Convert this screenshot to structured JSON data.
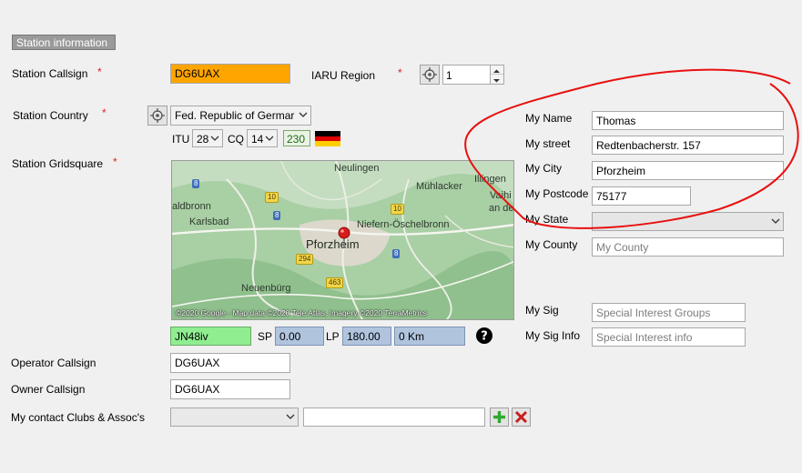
{
  "header": {
    "title": "Station information"
  },
  "callsign": {
    "label": "Station Callsign",
    "value": "DG6UAX"
  },
  "iaru": {
    "label": "IARU Region",
    "value": "1"
  },
  "country": {
    "label": "Station Country",
    "value": "Fed. Republic of Germar",
    "flag_icon": "germany-flag-icon"
  },
  "zones": {
    "itu_label": "ITU",
    "itu_value": "28",
    "cq_label": "CQ",
    "cq_value": "14",
    "dxcc": "230"
  },
  "gridsquare": {
    "label": "Station Gridsquare",
    "value": "JN48iv"
  },
  "map": {
    "places": [
      "Neulingen",
      "Mühlacker",
      "Illingen",
      "aldbronn",
      "Vaihi",
      "an de",
      "Karlsbad",
      "Niefern-Öschelbronn",
      "Pforzheim",
      "Neuenbürg"
    ],
    "roads": [
      "8",
      "10",
      "8",
      "10",
      "294",
      "8",
      "463"
    ],
    "credit": "©2020 Google - Map data ©2020 Tele Atlas, Imagery ©2020 TerraMetrics"
  },
  "bearing": {
    "sp_label": "SP",
    "sp_value": "0.00",
    "lp_label": "LP",
    "lp_value": "180.00",
    "distance": "0 Km",
    "help_icon": "help-icon"
  },
  "operator": {
    "label": "Operator Callsign",
    "value": "DG6UAX"
  },
  "owner": {
    "label": "Owner Callsign",
    "value": "DG6UAX"
  },
  "clubs": {
    "label": "My contact Clubs & Assoc's",
    "select_value": "",
    "text_value": "",
    "add_icon": "plus-icon",
    "remove_icon": "close-icon"
  },
  "personal": {
    "name_label": "My Name",
    "name_value": "Thomas",
    "street_label": "My street",
    "street_value": "Redtenbacherstr. 157",
    "city_label": "My City",
    "city_value": "Pforzheim",
    "postcode_label": "My Postcode",
    "postcode_value": "75177",
    "state_label": "My State",
    "state_value": "",
    "county_label": "My County",
    "county_placeholder": "My County",
    "sig_label": "My Sig",
    "sig_placeholder": "Special Interest Groups",
    "siginfo_label": "My Sig Info",
    "siginfo_placeholder": "Special Interest info"
  },
  "colors": {
    "callsign_bg": "#ffa500",
    "grid_bg": "#90ee90",
    "bearing_bg": "#b0c4de",
    "annotation": "#e81010"
  }
}
